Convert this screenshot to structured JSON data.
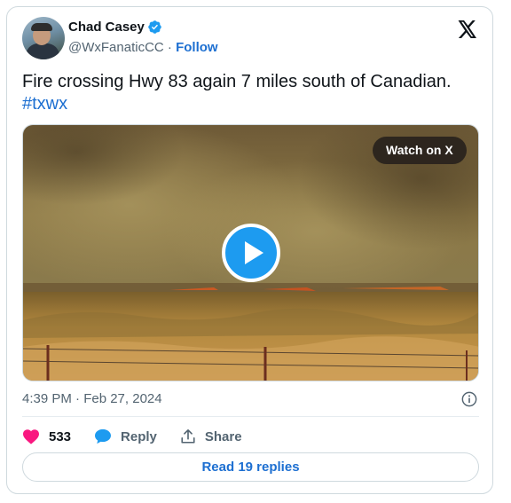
{
  "author": {
    "name": "Chad Casey",
    "handle": "@WxFanaticCC",
    "separator": "·",
    "follow_label": "Follow"
  },
  "tweet": {
    "text": "Fire crossing Hwy 83 again 7 miles south of Canadian.",
    "hashtag": "#txwx"
  },
  "media": {
    "watch_label": "Watch on X",
    "play_icon": "play-icon"
  },
  "meta": {
    "timestamp": "4:39 PM · Feb 27, 2024"
  },
  "actions": {
    "likes_count": "533",
    "reply_label": "Reply",
    "share_label": "Share"
  },
  "replies_button": "Read 19 replies",
  "colors": {
    "accent": "#1d9bf0",
    "link": "#1d6fd1",
    "like": "#f91880",
    "muted": "#536471"
  }
}
